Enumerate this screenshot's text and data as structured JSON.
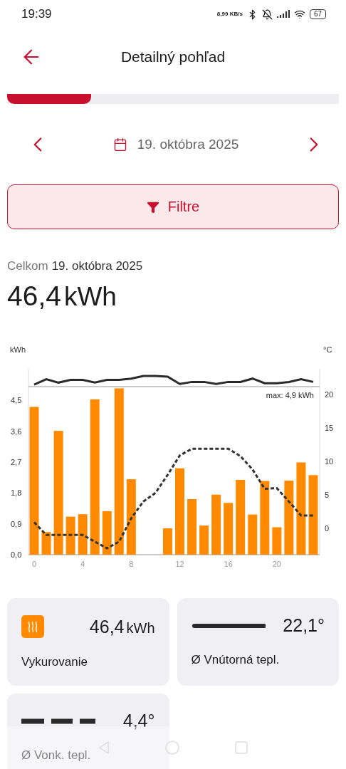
{
  "status_bar": {
    "time": "19:39",
    "net_speed_value": "8,99",
    "net_speed_unit": "KB/s",
    "battery": "67"
  },
  "header": {
    "title": "Detailný pohľad"
  },
  "date_nav": {
    "date": "19. októbra 2025"
  },
  "filter_button": {
    "label": "Filtre"
  },
  "summary": {
    "label": "Celkom",
    "date": "19. októbra 2025",
    "value": "46,4",
    "unit": "kWh"
  },
  "chart": {
    "chart_data": {
      "type": "bar",
      "ylabel": "kWh",
      "x": [
        0,
        1,
        2,
        3,
        4,
        5,
        6,
        7,
        8,
        11,
        12,
        13,
        14,
        15,
        16,
        17,
        18,
        19,
        20,
        21,
        22,
        23
      ],
      "xlim": [
        -0.47,
        23.53
      ],
      "xticks": [
        0,
        4,
        8,
        12,
        16,
        20
      ],
      "ylim": [
        0,
        4.9
      ],
      "yticks": [
        {
          "value": 0,
          "label": "0,0"
        },
        {
          "value": 0.9,
          "label": "0,9"
        },
        {
          "value": 1.8,
          "label": "1,8"
        },
        {
          "value": 2.7,
          "label": "2,7"
        },
        {
          "value": 3.6,
          "label": "3,6"
        },
        {
          "value": 4.5,
          "label": "4,5"
        }
      ],
      "series": [
        {
          "color": "#ff8a00",
          "values": [
            4.31,
            0.66,
            3.61,
            1.11,
            1.18,
            4.53,
            1.27,
            4.85,
            2.2,
            0.77,
            2.52,
            1.62,
            0.85,
            1.75,
            1.51,
            2.18,
            1.17,
            2.15,
            0.8,
            2.16,
            2.69,
            2.32
          ]
        }
      ],
      "annotations": [
        {
          "text": "max: 4,9 kWh"
        }
      ]
    }
  },
  "temperature_chart": {
    "chart_data": {
      "type": "line",
      "ylabel": "°C",
      "x": [
        0,
        1,
        2,
        3,
        4,
        5,
        6,
        7,
        8,
        9,
        10,
        11,
        12,
        13,
        14,
        15,
        16,
        17,
        18,
        19,
        20,
        21,
        22,
        23
      ],
      "xlim": [
        -0.47,
        23.53
      ],
      "ylim": [
        -3.95,
        23.86
      ],
      "yticks": [
        0,
        5,
        10,
        15,
        20
      ],
      "series": [
        {
          "color": "#2a2a2a",
          "line_style": "solid",
          "values": [
            21.5,
            22.3,
            21.8,
            22.2,
            22.2,
            21.8,
            22.2,
            22.2,
            22.4,
            22.8,
            22.8,
            22.7,
            21.6,
            21.9,
            21.9,
            21.6,
            21.9,
            21.9,
            22.4,
            21.7,
            21.7,
            21.9,
            22.3,
            21.9
          ]
        },
        {
          "color": "#333333",
          "line_style": "dashed",
          "values": [
            0.9,
            -1,
            -1,
            -1,
            -1,
            -2,
            -3,
            -2,
            1.5,
            4,
            5.3,
            8,
            10.9,
            11.9,
            11.9,
            11.9,
            11.9,
            10.8,
            8.8,
            5.9,
            6,
            4,
            1.9,
            1.9
          ]
        }
      ]
    }
  },
  "cards": [
    {
      "kind": "heating",
      "value": "46,4",
      "unit": "kWh",
      "label": "Vykurovanie"
    },
    {
      "kind": "solid_line",
      "value": "22,1°",
      "label": "Ø Vnútorná tepl."
    },
    {
      "kind": "dashed_line",
      "value": "4,4°",
      "label": "Ø Vonk. tepl."
    }
  ]
}
